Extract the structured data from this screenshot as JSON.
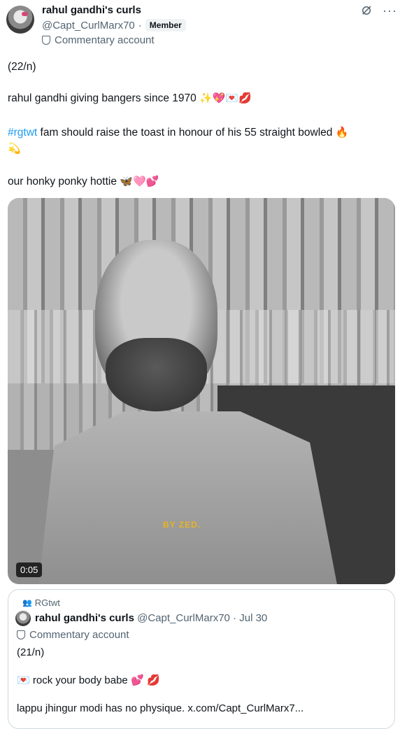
{
  "author": {
    "name": "rahul gandhi's curls",
    "handle": "@Capt_CurlMarx70",
    "separator": "·",
    "badge": "Member",
    "label": "Commentary account"
  },
  "tweet": {
    "line1": "(22/n)",
    "line2": "rahul gandhi giving bangers since 1970",
    "line2_emoji": "✨💖💌💋",
    "line3_hashtag": "#rgtwt",
    "line3_text": " fam should raise the toast in honour of his 55 straight bowled ",
    "line3_emoji": "🔥",
    "line3b_emoji": "💫",
    "line4": "our honky ponky hottie",
    "line4_emoji": "🦋🩷💕"
  },
  "media": {
    "watermark": "BY ZED.",
    "duration": "0:05"
  },
  "quote": {
    "community": "RGtwt",
    "name": "rahul gandhi's curls",
    "handle": "@Capt_CurlMarx70",
    "date": "· Jul 30",
    "label": "Commentary account",
    "line1": "(21/n)",
    "line2_emoji_a": "💌",
    "line2": " rock your body babe ",
    "line2_emoji_b": "💕 💋",
    "line3": "lappu jhingur modi has no physique.  x.com/Capt_CurlMarx7..."
  },
  "icons": [
    "avatar",
    "grok-icon",
    "more-icon",
    "shield-icon",
    "people-icon"
  ],
  "colors": {
    "accent": "#1d9bf0",
    "muted": "#536471",
    "text": "#0f1419",
    "watermark": "#e8b423"
  }
}
